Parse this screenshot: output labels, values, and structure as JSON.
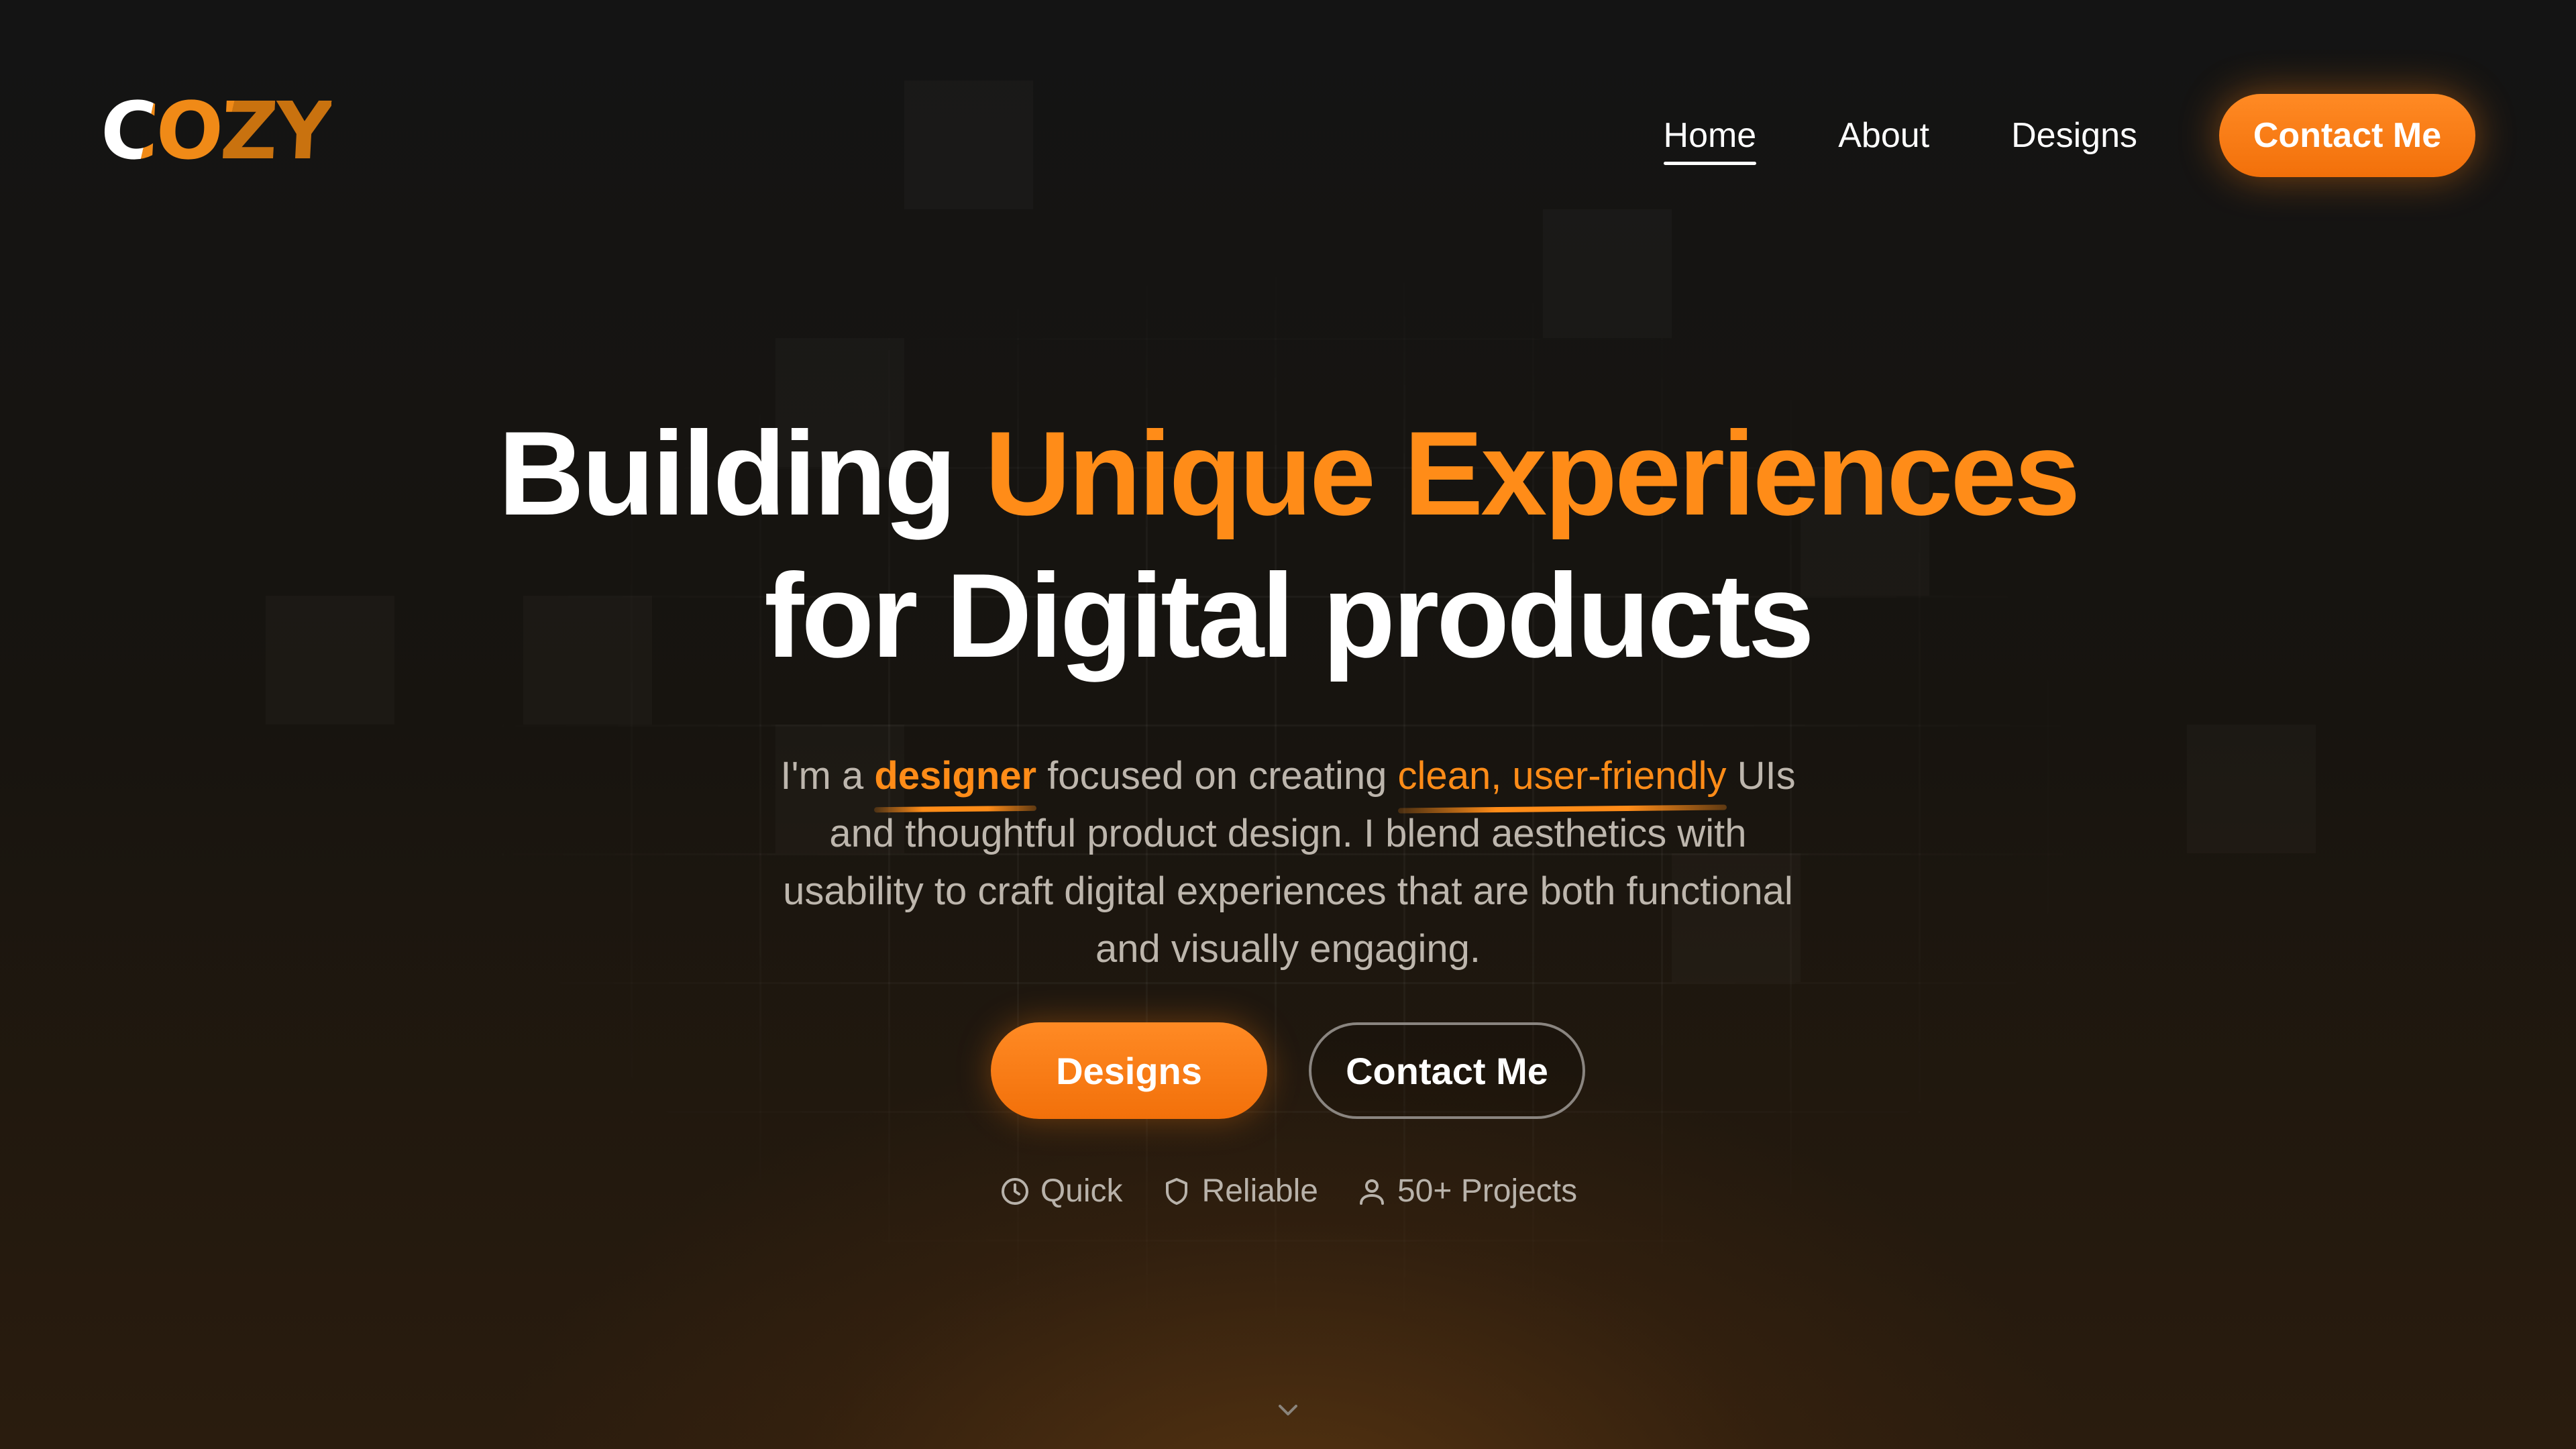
{
  "brand": {
    "logo_text": "COZY",
    "accent_color": "#ff8c18"
  },
  "nav": {
    "links": [
      {
        "label": "Home",
        "active": true
      },
      {
        "label": "About",
        "active": false
      },
      {
        "label": "Designs",
        "active": false
      }
    ],
    "contact_label": "Contact Me"
  },
  "hero": {
    "headline_part1": "Building ",
    "headline_accent": "Unique Experiences",
    "headline_line2": "for Digital products",
    "sub": {
      "t1": "I'm a ",
      "h1": "designer",
      "t2": " focused on creating ",
      "h2": "clean, user-friendly",
      "t3": " UIs and thoughtful product design. I blend aesthetics with usability to craft digital experiences that are both functional and visually engaging."
    },
    "primary_cta": "Designs",
    "secondary_cta": "Contact Me",
    "features": [
      {
        "icon": "clock-icon",
        "label": "Quick"
      },
      {
        "icon": "shield-icon",
        "label": "Reliable"
      },
      {
        "icon": "user-icon",
        "label": "50+ Projects"
      }
    ]
  },
  "scroll": {
    "icon": "chevron-down-icon"
  }
}
